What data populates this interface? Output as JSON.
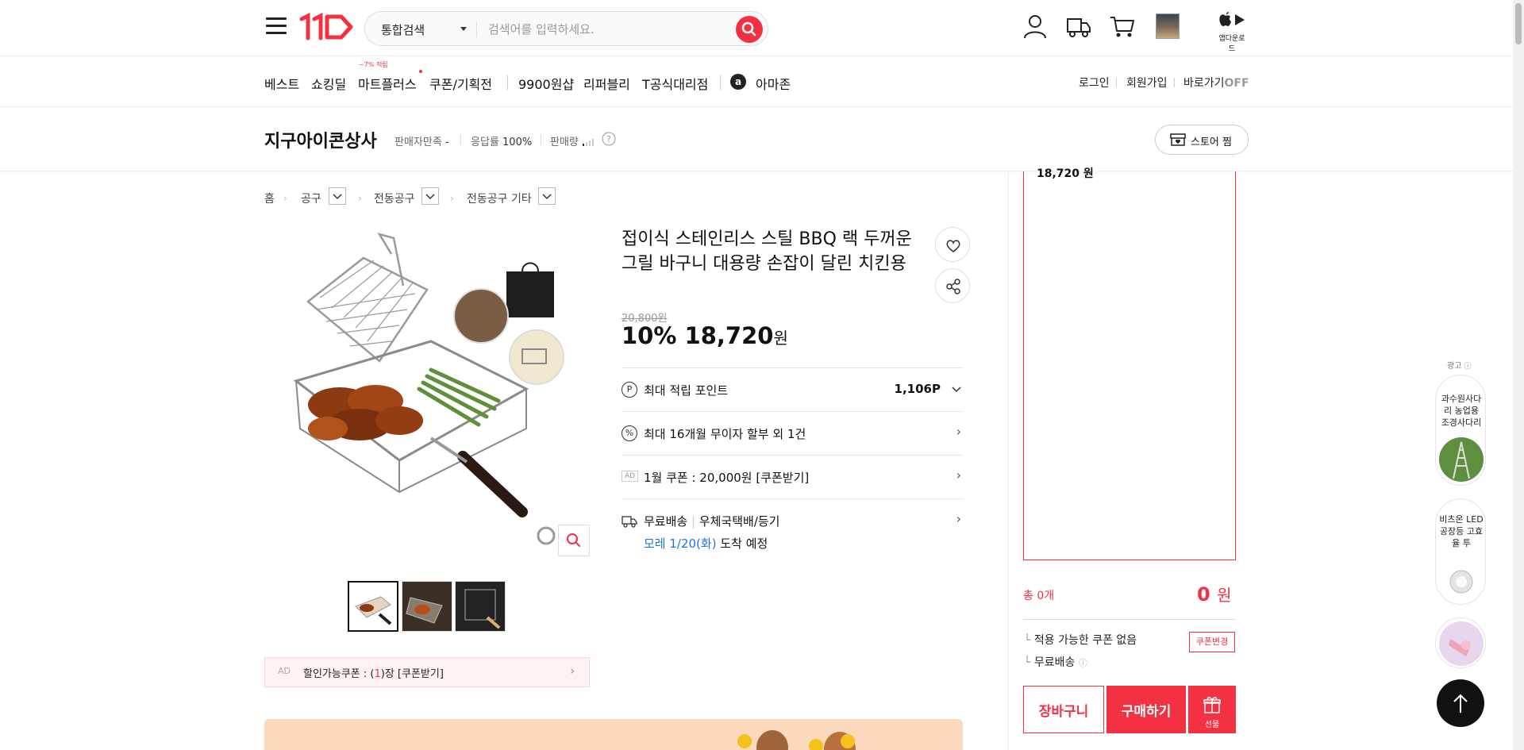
{
  "header": {
    "logo_text": "11",
    "search_category": "통합검색",
    "search_placeholder": "검색어를 입력하세요.",
    "app_download_label": "앱다운로드"
  },
  "nav": {
    "items": [
      "베스트",
      "쇼킹딜",
      "마트플러스",
      "쿠폰/기획전",
      "9900원샵",
      "리퍼블리",
      "T공식대리점",
      "아마존"
    ],
    "mart_badge": "~7% 적립",
    "login": "로그인",
    "signup": "회원가입",
    "shortcut": "바로가기",
    "shortcut_state": "OFF"
  },
  "store": {
    "name": "지구아이콘상사",
    "satisfaction_label": "판매자만족",
    "satisfaction_value": "-",
    "response_label": "응답률",
    "response_value": "100%",
    "sales_label": "판매량",
    "follow_button": "스토어 찜"
  },
  "breadcrumb": [
    "홈",
    "공구",
    "전동공구",
    "전동공구 기타"
  ],
  "product": {
    "title": "접이식 스테인리스 스틸 BBQ 랙 두꺼운 그릴 바구니 대용량 손잡이 달린 치킨용",
    "original_price": "20,800원",
    "discount": "10%",
    "sale_price": "18,720",
    "sale_unit": "원",
    "points_label": "최대 적립 포인트",
    "points_value": "1,106P",
    "installment": "최대 16개월 무이자 할부 외 1건",
    "ad_badge": "AD",
    "coupon_row": "1월 쿠폰 : 20,000원 [쿠폰받기]",
    "delivery_label": "무료배송",
    "delivery_method": "우체국택배/등기",
    "delivery_date": "모레 1/20(화)",
    "delivery_suffix": "도착 예정"
  },
  "coupon_bar": {
    "ad": "AD",
    "text_prefix": "할인가능쿠폰 : (",
    "count": "1",
    "text_suffix": ")장 [쿠폰받기]"
  },
  "panel": {
    "top_price": "18,720 원",
    "total_label": "총 0개",
    "total_value": "0",
    "total_unit": "원",
    "coupon_none": "적용 가능한 쿠폰 없음",
    "coupon_change": "쿠폰변경",
    "free_shipping": "무료배송",
    "cart_button": "장바구니",
    "buy_button": "구매하기",
    "gift_button": "선물"
  },
  "ads": {
    "label": "광고",
    "cards": [
      {
        "text": "과수원사다리 농업용 조경사다리"
      },
      {
        "text": "비츠온 LED공장등 고효율 투"
      }
    ]
  },
  "colors": {
    "brand_red": "#f43142",
    "link_blue": "#1b74d6"
  }
}
